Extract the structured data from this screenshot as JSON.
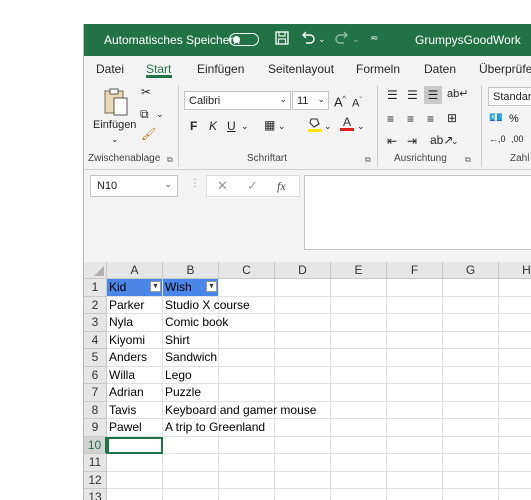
{
  "titlebar": {
    "autosave_label": "Automatisches Speichern",
    "filename": "GrumpysGoodWork",
    "icons": [
      "save-icon",
      "undo-icon",
      "redo-icon",
      "customize-icon"
    ]
  },
  "tabs": [
    "Datei",
    "Start",
    "Einfügen",
    "Seitenlayout",
    "Formeln",
    "Daten",
    "Überprüfe"
  ],
  "active_tab": "Start",
  "ribbon": {
    "clipboard": {
      "paste_label": "Einfügen",
      "group_label": "Zwischenablage"
    },
    "font": {
      "font_name": "Calibri",
      "font_size": "11",
      "bold": "F",
      "italic": "K",
      "underline": "U",
      "group_label": "Schriftart"
    },
    "alignment": {
      "group_label": "Ausrichtung"
    },
    "number": {
      "format": "Standard",
      "group_label": "Zahl"
    }
  },
  "formula_bar": {
    "name_box": "N10",
    "fx": "fx",
    "content": ""
  },
  "sheet": {
    "columns": [
      "A",
      "B",
      "C",
      "D",
      "E",
      "F",
      "G",
      "H"
    ],
    "rows": [
      "1",
      "2",
      "3",
      "4",
      "5",
      "6",
      "7",
      "8",
      "9",
      "10",
      "11",
      "12",
      "13"
    ],
    "selected_row": "10",
    "table_headers": [
      "Kid",
      "Wish"
    ],
    "data": [
      [
        "Parker",
        "Studio X course"
      ],
      [
        "Nyla",
        "Comic book"
      ],
      [
        "Kiyomi",
        "Shirt"
      ],
      [
        "Anders",
        "Sandwich"
      ],
      [
        "Willa",
        "Lego"
      ],
      [
        "Adrian",
        "Puzzle"
      ],
      [
        "Tavis",
        "Keyboard and gamer mouse"
      ],
      [
        "Pawel",
        "A trip to Greenland"
      ]
    ]
  },
  "colors": {
    "title_bar": "#217346",
    "table_header": "#4a86e8",
    "accent": "#217346"
  }
}
